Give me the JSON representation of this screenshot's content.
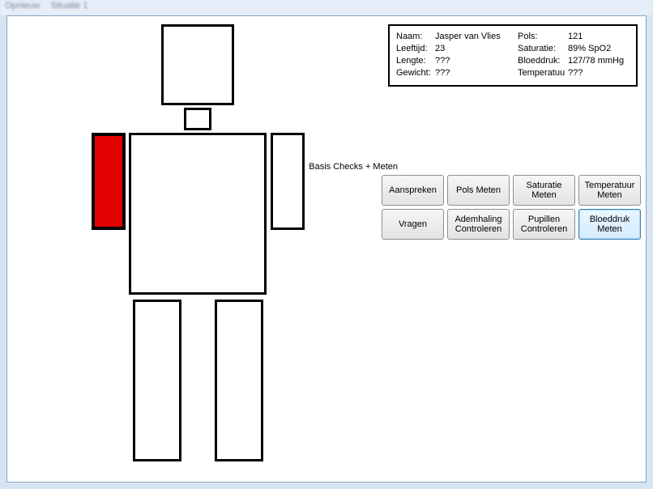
{
  "menu": {
    "item1": "Opnieuw",
    "item2": "Situatie 1"
  },
  "info": {
    "labels": {
      "name": "Naam:",
      "age": "Leeftijd:",
      "height": "Lengte:",
      "weight": "Gewicht:",
      "pulse": "Pols:",
      "saturation": "Saturatie:",
      "bp": "Bloeddruk:",
      "temp": "Temperatuur:"
    },
    "values": {
      "name": "Jasper van Vlies",
      "age": "23",
      "height": "???",
      "weight": "???",
      "pulse": "121",
      "saturation": "89% SpO2",
      "bp": "127/78 mmHg",
      "temp": "???"
    }
  },
  "section_title": "Basis Checks + Meten",
  "buttons": {
    "b1": "Aanspreken",
    "b2": "Pols Meten",
    "b3": "Saturatie Meten",
    "b4": "Temperatuur Meten",
    "b5": "Vragen",
    "b6": "Ademhaling Controleren",
    "b7": "Pupillen Controleren",
    "b8": "Bloeddruk Meten"
  },
  "body_parts": {
    "injured": "arm-left"
  }
}
